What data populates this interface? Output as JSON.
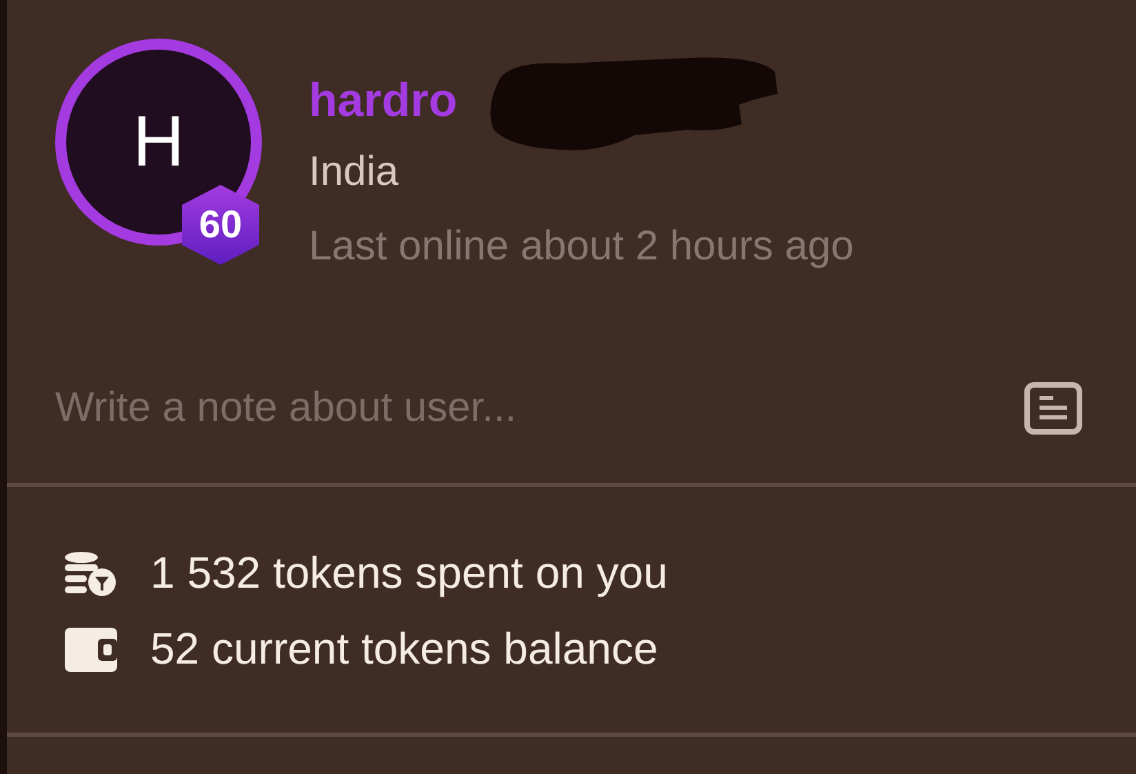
{
  "profile": {
    "avatar_letter": "H",
    "level_badge": "60",
    "username": "hardro",
    "country": "India",
    "last_online": "Last online about 2 hours ago"
  },
  "note": {
    "placeholder": "Write a note about user..."
  },
  "stats": [
    {
      "kind": "spent",
      "text": "1 532 tokens spent on you"
    },
    {
      "kind": "balance",
      "text": "52 current tokens balance"
    }
  ]
}
